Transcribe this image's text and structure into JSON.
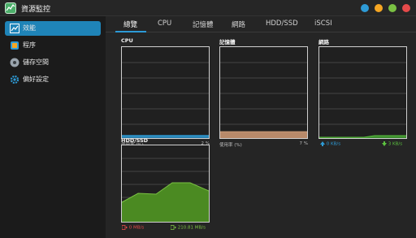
{
  "window": {
    "title": "資源監控"
  },
  "colors": {
    "accent": "#1f84b8",
    "dot1": "#2e9bd6",
    "dot2": "#f5a623",
    "dot3": "#7ac143",
    "dot4": "#e64a4a"
  },
  "sidebar": {
    "items": [
      {
        "label": "效能",
        "icon": "chart-icon"
      },
      {
        "label": "程序",
        "icon": "process-icon"
      },
      {
        "label": "儲存空間",
        "icon": "storage-icon"
      },
      {
        "label": "偏好設定",
        "icon": "gear-icon"
      }
    ]
  },
  "tabs": [
    "總覽",
    "CPU",
    "記憶體",
    "網路",
    "HDD/SSD",
    "iSCSI"
  ],
  "panels": {
    "cpu": {
      "title": "CPU",
      "usage_label": "使用率 (%)",
      "usage_value": "2 %",
      "usage_fraction": 0.02
    },
    "memory": {
      "title": "記憶體",
      "usage_label": "使用率 (%)",
      "usage_value": "7 %",
      "usage_fraction": 0.07
    },
    "network": {
      "title": "網路",
      "up": "0 KB/s",
      "down": "3 KB/s"
    },
    "disk": {
      "title": "HDD/SSD",
      "read": "0 MB/s",
      "write": "210.81 MB/s"
    }
  }
}
